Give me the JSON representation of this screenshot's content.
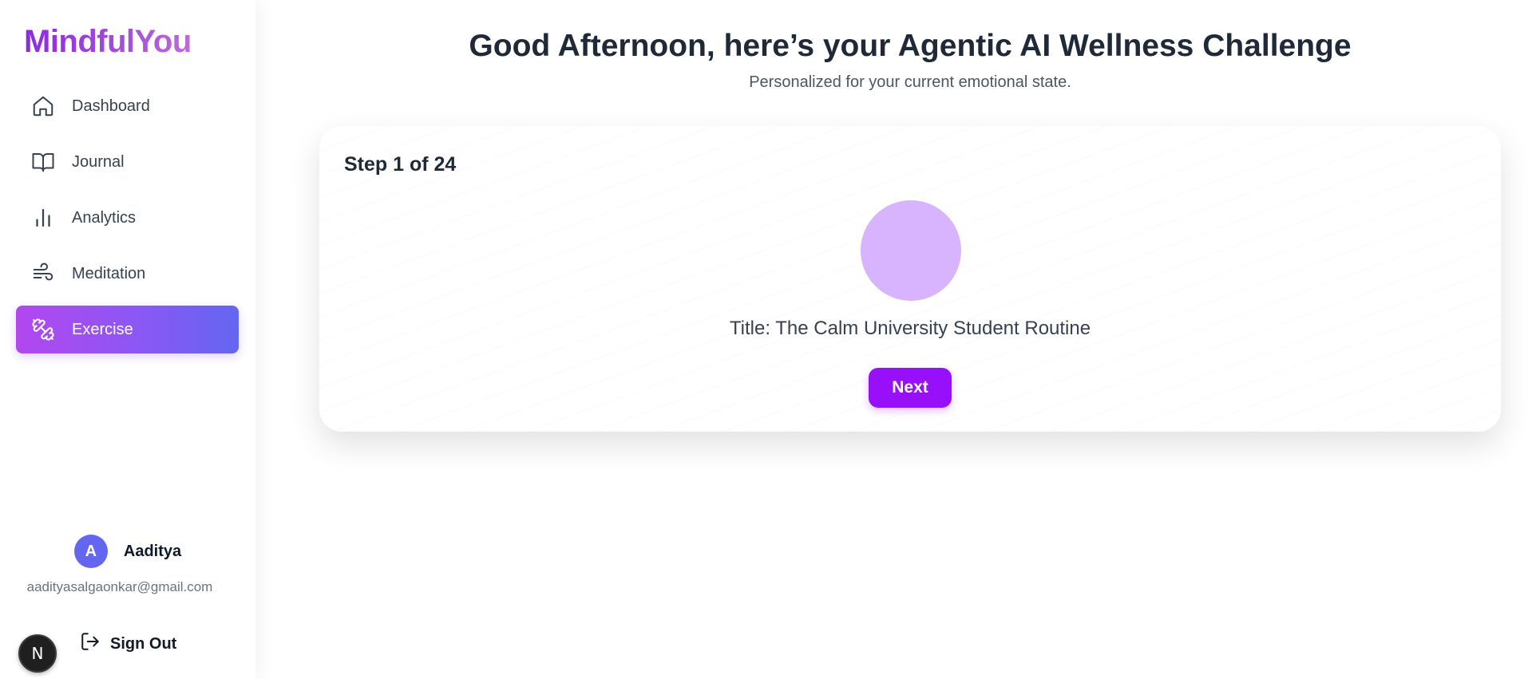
{
  "sidebar": {
    "logo": "MindfulYou",
    "items": [
      {
        "label": "Dashboard",
        "icon": "home-icon"
      },
      {
        "label": "Journal",
        "icon": "book-icon"
      },
      {
        "label": "Analytics",
        "icon": "bar-chart-icon"
      },
      {
        "label": "Meditation",
        "icon": "wind-icon"
      },
      {
        "label": "Exercise",
        "icon": "dumbbell-icon",
        "active": true
      }
    ],
    "user": {
      "initial": "A",
      "name": "Aaditya",
      "email": "aadityasalgaonkar@gmail.com"
    },
    "signout_label": "Sign Out",
    "nextjs_badge": "N"
  },
  "main": {
    "title": "Good Afternoon, here’s your Agentic AI Wellness Challenge",
    "subtitle": "Personalized for your current emotional state.",
    "card": {
      "step_label": "Step 1 of 24",
      "step_title": "Title: The Calm University Student Routine",
      "next_label": "Next"
    }
  },
  "colors": {
    "accent": "#9810fa",
    "active_gradient_start": "#b247ef",
    "active_gradient_end": "#6366f1",
    "circle": "#d8b4fe",
    "avatar": "#6366f1"
  }
}
